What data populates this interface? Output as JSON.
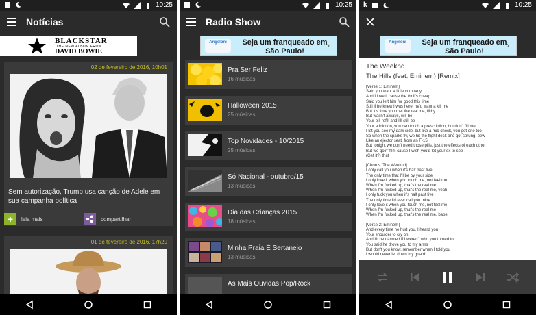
{
  "status": {
    "time": "10:25"
  },
  "screen1": {
    "title": "Notícias",
    "ad": {
      "line1": "BLACKSTAR",
      "line2": "THE NEW ALBUM FROM",
      "line3": "DAVID BOWIE"
    },
    "news": [
      {
        "date": "02 de fevereiro de 2016, 10h01",
        "headline": "Sem autorização, Trump usa canção de Adele em sua campanha política",
        "read_more": "leia mais",
        "share": "compartilhar"
      },
      {
        "date": "01 de fevereiro de 2016, 17h20"
      }
    ]
  },
  "screen2": {
    "title": "Radio Show",
    "ad": {
      "logo": "Angeloni",
      "text": "Seja um franqueado em São Paulo!"
    },
    "playlists": [
      {
        "name": "Pra Ser Feliz",
        "count": "16 músicas"
      },
      {
        "name": "Halloween 2015",
        "count": "25 músicas"
      },
      {
        "name": "Top Novidades - 10/2015",
        "count": "25 músicas"
      },
      {
        "name": "Só Nacional - outubro/15",
        "count": "13 músicas"
      },
      {
        "name": "Dia das Crianças 2015",
        "count": "18 músicas"
      },
      {
        "name": "Minha Praia É Sertanejo",
        "count": "13 músicas"
      },
      {
        "name": "As Mais Ouvidas Pop/Rock",
        "count": ""
      }
    ]
  },
  "screen3": {
    "ad": {
      "logo": "Angeloni",
      "text": "Seja um franqueado em São Paulo!"
    },
    "artist": "The Weeknd",
    "song": "The Hills (feat. Eminem) [Remix]",
    "lyrics": "[Verse 1: Eminem]\nSaid you want a little company\nAnd I love it cause the thrill's cheap\nSaid you left him for good this time\nStill if he knew I was here, he'd wanna kill me\nBut it's time you met the real me, filthy\nBut wasn't always, will be\nYour pill refill and I'll still be\nYour addiction, you can touch a prescription, but don't fill me\nI let you see my dark side, but like a mic-check, you got one too\nSo when the sparks fly, we hit the flight deck and got sprung, pew\nLike an ejector seat, from an F-15\nBut tonight we don't need those pills, just the effects of each other\nBut we goin' film cause I wish you'd let your ex to see\n(Get it?) that\n\n[Chorus: The Weeknd]\nI only call you when it's half past five\nThe only time that I'll be by your side\nI only love it when you touch me, not feel me\nWhen I'm fucked up, that's the real me\nWhen I'm fucked up, that's the real me, yeah\nI only fuck you when it's half past five\nThe only time I'd ever call you mine\nI only love it when you touch me, not feel me\nWhen I'm fucked up, that's the real me\nWhen I'm fucked up, that's the real me, babe\n\n[Verse 2: Eminem]\nAnd every time he hurt you, I heard you\nYour shoulder to cry on\nAnd I'll be damned if I weren't who you turned to\nYou said he drove you to my arms\nBut don't you know, remember when I told you\nI would never let down my guard\nI would never let her down my guard\nCause is it really over?"
  },
  "colors": {
    "date": "#c7c01d",
    "readmore": "#8db32b",
    "share": "#7d5c9e"
  }
}
